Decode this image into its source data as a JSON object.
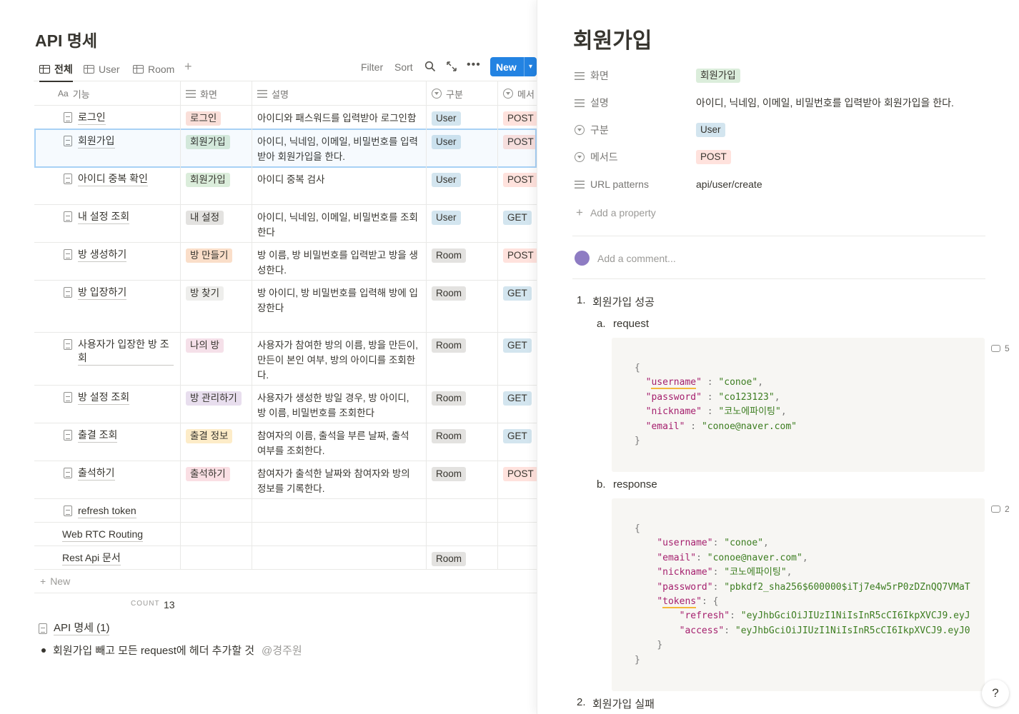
{
  "database": {
    "title": "API 명세",
    "views": [
      {
        "label": "전체",
        "active": true
      },
      {
        "label": "User",
        "active": false
      },
      {
        "label": "Room",
        "active": false
      }
    ],
    "toolbar": {
      "filter": "Filter",
      "sort": "Sort",
      "new_label": "New"
    },
    "columns": {
      "name": "기능",
      "screen": "화면",
      "desc": "설명",
      "type": "구분",
      "method": "메서"
    },
    "rows": [
      {
        "name": "로그인",
        "doc": true,
        "screen": "로그인",
        "screen_color": "#fadfd9",
        "desc": "아이디와 패스워드를 입력받아 로그인함",
        "type": "User",
        "method": "POST"
      },
      {
        "name": "회원가입",
        "doc": true,
        "screen": "회원가입",
        "screen_color": "#dbeddb",
        "desc": "아이디, 닉네임, 이메일, 비밀번호를 입력받아 회원가입을 한다.",
        "type": "User",
        "method": "POST"
      },
      {
        "name": "아이디 중복 확인",
        "doc": true,
        "screen": "회원가입",
        "screen_color": "#dbeddb",
        "desc": "아이디 중복 검사",
        "type": "User",
        "method": "POST"
      },
      {
        "name": "내 설정 조회",
        "doc": true,
        "screen": "내 설정",
        "screen_color": "#e3e2e0",
        "desc": "아이디, 닉네임, 이메일, 비밀번호를 조회한다",
        "type": "User",
        "method": "GET"
      },
      {
        "name": "방 생성하기",
        "doc": true,
        "screen": "방 만들기",
        "screen_color": "#fadec9",
        "desc": "방 이름, 방 비밀번호를 입력받고 방을 생성한다.",
        "type": "Room",
        "method": "POST"
      },
      {
        "name": "방 입장하기",
        "doc": true,
        "screen": "방 찾기",
        "screen_color": "#eeeeec",
        "desc": "방 아이디, 방 비밀번호를 입력해 방에 입장한다",
        "type": "Room",
        "method": "GET"
      },
      {
        "name": "사용자가 입장한 방 조회",
        "doc": true,
        "screen": "나의 방",
        "screen_color": "#f5e0e9",
        "desc": "사용자가 참여한 방의 이름, 방을 만든이, 만든이 본인 여부, 방의 아이디를 조회한다.",
        "type": "Room",
        "method": "GET"
      },
      {
        "name": "방 설정 조회",
        "doc": true,
        "screen": "방 관리하기",
        "screen_color": "#e8deee",
        "desc": "사용자가 생성한 방일 경우, 방 아이디, 방 이름, 비밀번호를 조회한다",
        "type": "Room",
        "method": "GET"
      },
      {
        "name": "출결 조회",
        "doc": true,
        "screen": "출결 정보",
        "screen_color": "#fdecc8",
        "desc": "참여자의 이름, 출석을 부른 날짜, 출석 여부를 조회한다.",
        "type": "Room",
        "method": "GET"
      },
      {
        "name": "출석하기",
        "doc": true,
        "screen": "출석하기",
        "screen_color": "#fadfe4",
        "desc": "참여자가 출석한 날짜와 참여자와 방의 정보를 기록한다.",
        "type": "Room",
        "method": "POST"
      },
      {
        "name": "refresh token",
        "doc": true,
        "screen": "",
        "screen_color": "",
        "desc": "",
        "type": "",
        "method": ""
      },
      {
        "name": "Web RTC Routing",
        "doc": false,
        "screen": "",
        "screen_color": "",
        "desc": "",
        "type": "",
        "method": ""
      },
      {
        "name": "Rest Api 문서",
        "doc": false,
        "screen": "",
        "screen_color": "",
        "desc": "",
        "type": "Room",
        "method": ""
      }
    ],
    "new_row_label": "New",
    "count_label": "COUNT",
    "count_value": "13",
    "linked_page": "API 명세 (1)",
    "note_text": "회원가입 빼고 모든 request에 헤더 추가할 것",
    "note_mention": "@경주원"
  },
  "tag_colors": {
    "User": "#d3e5ef",
    "Room": "#e3e2e0",
    "POST": "#ffe2dd",
    "GET": "#d3e5ef"
  },
  "detail": {
    "title": "회원가입",
    "properties": [
      {
        "name": "화면",
        "value": "회원가입",
        "kind": "tag",
        "color": "#dbeddb",
        "icon": "list-icon"
      },
      {
        "name": "설명",
        "value": "아이디, 닉네임, 이메일, 비밀번호를 입력받아 회원가입을 한다.",
        "kind": "text",
        "icon": "text-icon"
      },
      {
        "name": "구분",
        "value": "User",
        "kind": "tag",
        "color": "#d3e5ef",
        "icon": "select-icon"
      },
      {
        "name": "메서드",
        "value": "POST",
        "kind": "tag",
        "color": "#ffe2dd",
        "icon": "select-icon"
      },
      {
        "name": "URL patterns",
        "value": "api/user/create",
        "kind": "text",
        "icon": "text-icon"
      }
    ],
    "add_property": "Add a property",
    "comment_placeholder": "Add a comment...",
    "items": {
      "one_num": "1.",
      "one": "회원가입 성공",
      "a_num": "a.",
      "a": "request",
      "b_num": "b.",
      "b": "response",
      "two_num": "2.",
      "two": "회원가입 실패"
    },
    "request_comments": "5",
    "response_comments": "2",
    "request_code": [
      {
        "k": "username",
        "v": "conoe"
      },
      {
        "k": "password",
        "v": "co123123"
      },
      {
        "k": "nickname",
        "v": "코노에파이팅"
      },
      {
        "k": "email",
        "v": "conoe@naver.com"
      }
    ],
    "response_code": {
      "username": "conoe",
      "email": "conoe@naver.com",
      "nickname": "코노에파이팅",
      "password": "pbkdf2_sha256$600000$iTj7e4w5rP0zDZnQQ7VMaT",
      "tokens_key": "tokens",
      "refresh": "eyJhbGciOiJIUzI1NiIsInR5cCI6IkpXVCJ9.eyJ",
      "access": "eyJhbGciOiJIUzI1NiIsInR5cCI6IkpXVCJ9.eyJ0"
    },
    "help": "?"
  }
}
